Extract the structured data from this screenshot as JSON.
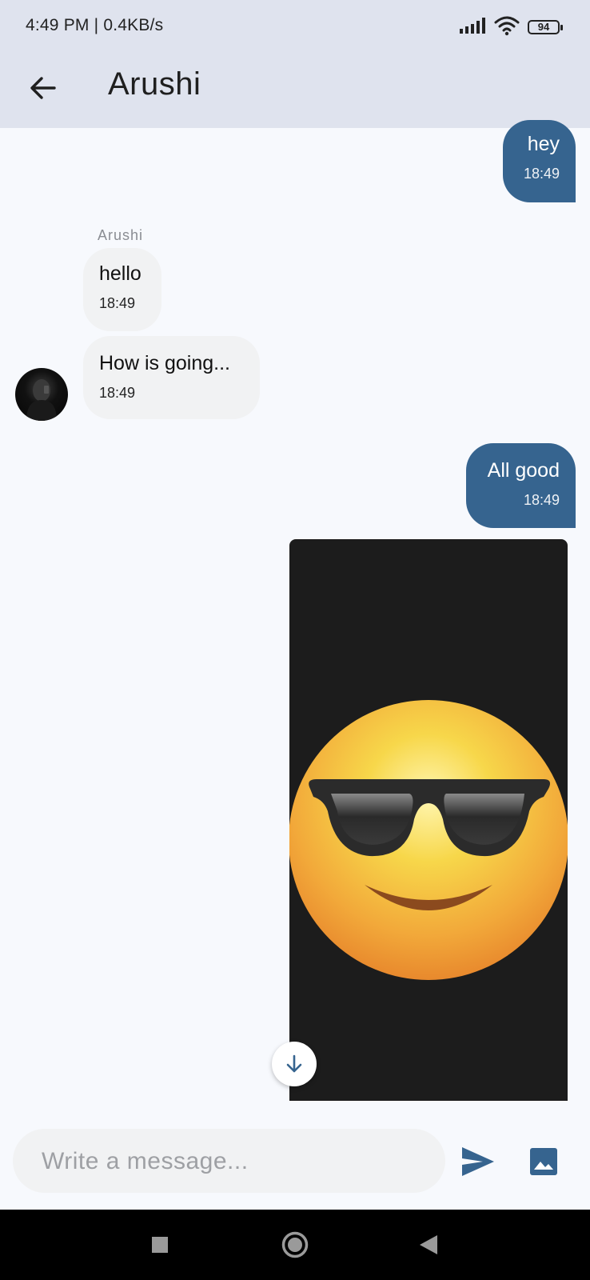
{
  "status_bar": {
    "time_speed": "4:49 PM | 0.4KB/s",
    "battery": "94"
  },
  "header": {
    "title": "Arushi"
  },
  "messages": [
    {
      "direction": "outgoing",
      "text": "hey",
      "time": "18:49"
    },
    {
      "direction": "incoming",
      "sender": "Arushi",
      "text": "hello",
      "time": "18:49"
    },
    {
      "direction": "incoming",
      "text": "How is going...",
      "time": "18:49"
    },
    {
      "direction": "outgoing",
      "text": "All good",
      "time": "18:49"
    },
    {
      "direction": "outgoing",
      "type": "image",
      "image_subject": "smiling-face-with-sunglasses-emoji"
    }
  ],
  "composer": {
    "placeholder": "Write a message..."
  },
  "icons": {
    "back": "arrow-left-icon",
    "scroll_down": "arrow-down-icon",
    "send": "send-icon",
    "image": "image-icon",
    "nav_recent": "square-icon",
    "nav_home": "circle-icon",
    "nav_back": "triangle-left-icon"
  },
  "colors": {
    "outgoing_bubble": "#36648f",
    "incoming_bubble": "#f1f2f3",
    "app_bar": "#dfe3ee",
    "background": "#f7f9fd",
    "accent": "#36648f"
  }
}
